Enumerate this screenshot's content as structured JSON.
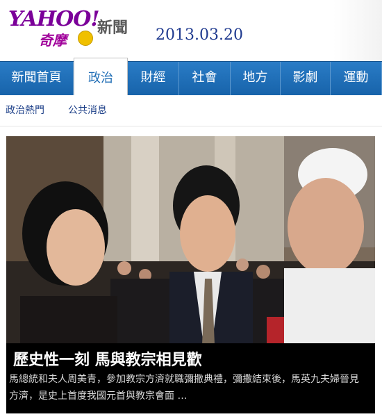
{
  "header": {
    "logo_yahoo": "YAHOO!",
    "logo_qimo": "奇摩",
    "section": "新聞",
    "date": "2013.03.20"
  },
  "nav": {
    "tabs": [
      {
        "label": "新聞首頁"
      },
      {
        "label": "政治",
        "active": true
      },
      {
        "label": "財經"
      },
      {
        "label": "社會"
      },
      {
        "label": "地方"
      },
      {
        "label": "影劇"
      },
      {
        "label": "運動"
      }
    ]
  },
  "subnav": {
    "items": [
      {
        "label": "政治熱門"
      },
      {
        "label": "公共消息"
      }
    ]
  },
  "story": {
    "headline": "歷史性一刻 馬與教宗相見歡",
    "summary": "馬總統和夫人周美青，參加教宗方濟就職彌撒典禮，彌撒結束後，馬英九夫婦晉見方濟，是史上首度我國元首與教宗會面 …"
  },
  "colors": {
    "nav_blue": "#1c6bb4",
    "date_blue": "#1f3a8f",
    "brand_purple": "#7b0099"
  }
}
